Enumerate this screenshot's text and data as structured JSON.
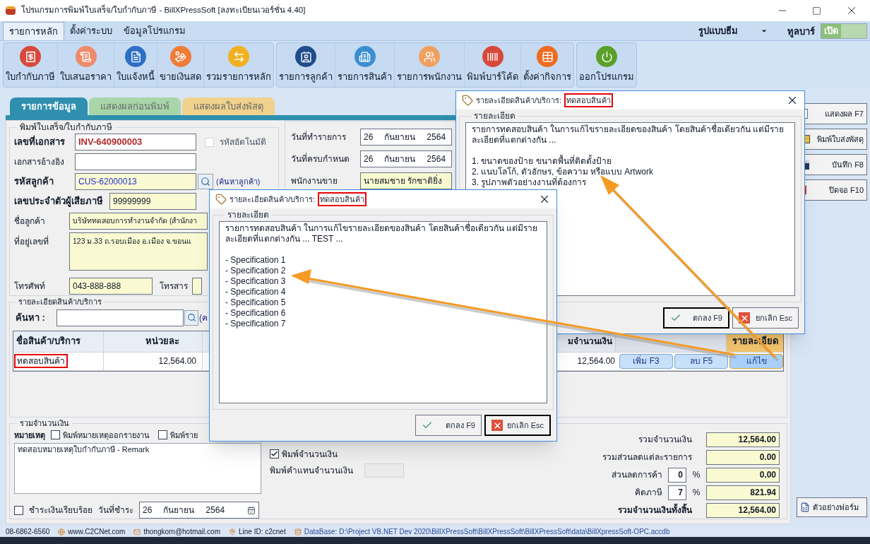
{
  "window": {
    "title": "โปรแกรมการพิมพ์ใบเสร็จ/ใบกำกับภาษี - BillXPressSoft [ลงทะเบียนเวอร์ชั่น 4.40]"
  },
  "menu_tabs": [
    {
      "label": "รายการหลัก",
      "selected": true
    },
    {
      "label": "ตั้งค่าระบบ",
      "selected": false
    },
    {
      "label": "ข้อมูลโปรแกรม",
      "selected": false
    }
  ],
  "theme": {
    "label": "รูปแบบธีม"
  },
  "toolbar": {
    "label": "ทูลบาร์",
    "value": "เปิด",
    "on": true
  },
  "ribbon": [
    {
      "items": [
        {
          "label": "ใบกำกับภาษี",
          "color": "#d8483a"
        },
        {
          "label": "ใบเสนอราคา",
          "color": "#ef8a6c"
        },
        {
          "label": "ใบแจ้งหนี้",
          "color": "#2f6fc6"
        },
        {
          "label": "ขายเงินสด",
          "color": "#f07c38"
        },
        {
          "label": "รวมรายการหลัก",
          "color": "#f0b020"
        }
      ]
    },
    {
      "items": [
        {
          "label": "รายการลูกค้า",
          "color": "#1f4d8c"
        },
        {
          "label": "รายการสินค้า",
          "color": "#3a8fd0"
        },
        {
          "label": "รายการพนักงาน",
          "color": "#f0a060"
        },
        {
          "label": "พิมพ์บาร์โค้ด",
          "color": "#d8483a"
        },
        {
          "label": "ตั้งค่ากิจการ",
          "color": "#f06a20"
        }
      ]
    },
    {
      "items": [
        {
          "label": "ออกโปรแกรม",
          "color": "#5aa02a"
        }
      ]
    }
  ],
  "doc_tabs": [
    {
      "label": "รายการข้อมูล",
      "selected": true,
      "color": "#2f8fae"
    },
    {
      "label": "แสดงผลก่อนพิมพ์",
      "selected": false,
      "color": "#a9d6a9"
    },
    {
      "label": "แสดงผลใบส่งพัสดุ",
      "selected": false,
      "color": "#f0d28c"
    }
  ],
  "document": {
    "title": "พิมพ์ใบเสร็จ/ใบกำกับภาษี",
    "doc_no": {
      "label": "เลขที่เอกสาร",
      "value": "INV-640900003",
      "auto": {
        "label": "รหัสอัตโนมัติ",
        "checked": false
      }
    },
    "reference": {
      "label": "เอกสารอ้างอิง"
    },
    "customer_code": {
      "label": "รหัสลูกค้า",
      "value": "CUS-62000013",
      "link": "(ค้นหาลูกค้า)"
    },
    "tax_id": {
      "label": "เลขประจำตัวผู้เสียภาษี",
      "value": "99999999"
    },
    "customer_name": {
      "label": "ชื่อลูกค้า",
      "value": "บริษัททดสอบการทำงานจำกัด (สำนักงา"
    },
    "address": {
      "label": "ที่อยู่เลขที่",
      "value": "123 ม.33 ถ.รอบเมือง อ.เมือง จ.ขอนแ"
    },
    "phone": {
      "label": "โทรศัพท์",
      "value": "043-888-888"
    },
    "fax": {
      "label": "โทรสาร"
    },
    "right_fields": [
      {
        "label": "วันที่ทำรายการ",
        "kind": "date",
        "day": "26",
        "month": "กันยายน",
        "year": "2564"
      },
      {
        "label": "วันที่ครบกำหนด",
        "kind": "date",
        "day": "26",
        "month": "กันยายน",
        "year": "2564"
      },
      {
        "label": "พนักงานขาย",
        "kind": "text",
        "value": "นายสมชาย รักชาติยิ่ง"
      }
    ]
  },
  "products": {
    "title": "รายละเอียดสินค้า/บริการ",
    "search_label": "ค้นหา :",
    "search_link": "(ค",
    "columns": [
      "ชื่อสินค้า/บริการ",
      "หน่วยละ",
      "มจำนวนเงิน",
      "รายละเอียด"
    ],
    "rows": [
      {
        "name": "ทดสอบสินค้า",
        "unit_price": "12,564.00",
        "amount": "12,564.00",
        "actions": [
          "เพิ่ม F3",
          "ลบ F5",
          "แก้ไข"
        ]
      }
    ]
  },
  "totals": {
    "title": "รวมจำนวนเงิน",
    "remark_label": "หมายเหตุ",
    "remark_options": [
      {
        "label": "พิมพ์หมายเหตุออกรายงาน",
        "checked": false
      },
      {
        "label": "พิมพ์ราย",
        "checked": false
      }
    ],
    "remark": "ทดสอบหมายเหตุใบกำกับภาษี - Remark",
    "paid": {
      "label": "ชำระเงินเรียบร้อย",
      "checked": false
    },
    "pay_date": {
      "label": "วันที่ชำระ",
      "day": "26",
      "month": "กันยายน",
      "year": "2564"
    },
    "print_amount": {
      "label": "พิมพ์จำนวนเงิน",
      "checked": true
    },
    "amount_words_label": "พิมพ์คำแทนจำนวนเงิน",
    "summary": [
      {
        "kind": "plain",
        "label": "รวมจำนวนเงิน",
        "value": "12,564.00"
      },
      {
        "kind": "plain",
        "label": "รวมส่วนลดแต่ละรายการ",
        "value": "0.00"
      },
      {
        "kind": "percent",
        "label": "ส่วนลดการค้า",
        "percent": "0",
        "unit": "%",
        "value": "0.00"
      },
      {
        "kind": "percent",
        "label": "คิดภาษี",
        "percent": "7",
        "unit": "%",
        "value": "821.94"
      },
      {
        "kind": "grand",
        "label": "รวมจำนวนเงินทั้งสิ้น",
        "value": "12,564.00"
      }
    ]
  },
  "side_buttons": [
    "แสดงผล F7",
    "พิมพ์ใบส่งพัสดุ",
    "บันทึก F8",
    "ปิดจอ F10"
  ],
  "form_sample_button": "ตัวอย่างฟอร์ม",
  "status_bar": [
    "08-6862-6560",
    "www.C2CNet.com",
    "thongkorn@hotmail.com",
    "Line ID: c2cnet",
    "DataBase: D:\\Project VB.NET Dev 2020\\BillXPressSoft\\BillXPressSoft\\BillXPressSoft\\data\\BillXpressSoft-OPC.accdb"
  ],
  "dialogs": [
    {
      "title": "รายละเอียดสินค้า/บริการ:",
      "highlight": "ทดสอบสินค้า",
      "group": "รายละเอียด",
      "paragraphs": [
        [
          "รายการทดสอบสินค้า ในการแก้ไขรายละเอียดของสินค้า โดยสินค้าชื่อเดียวกัน แต่มีราย",
          "ละเอียดที่แตกต่างกัน ..."
        ],
        [
          "1. ขนาดของป้าย ขนาดพื้นที่ติดตั้งป้าย",
          "2. แนบโลโก้, ตัวอักษร, ข้อความ หรือแบบ Artwork",
          "3. รูปภาพตัวอย่างงานที่ต้องการ"
        ]
      ],
      "buttons": [
        {
          "label": "ตกลง F9",
          "kind": "ok",
          "focused": true
        },
        {
          "label": "ยกเลิก Esc",
          "kind": "cancel",
          "focused": false
        }
      ]
    },
    {
      "title": "รายละเอียดสินค้า/บริการ:",
      "highlight": "ทดสอบสินค้า",
      "group": "รายละเอียด",
      "paragraphs": [
        [
          "รายการทดสอบสินค้า ในการแก้ไขรายละเอียดของสินค้า โดยสินค้าชื่อเดียวกัน แต่มีราย",
          "ละเอียดที่แตกต่างกัน ... TEST ..."
        ],
        [
          "- Specification 1",
          "- Specification 2",
          "- Specification 3",
          "- Specification 4",
          "- Specification 5",
          "- Specification 6",
          "- Specification 7"
        ]
      ],
      "buttons": [
        {
          "label": "ตกลง F9",
          "kind": "ok",
          "focused": false
        },
        {
          "label": "ยกเลิก Esc",
          "kind": "cancel",
          "focused": true
        }
      ]
    }
  ]
}
